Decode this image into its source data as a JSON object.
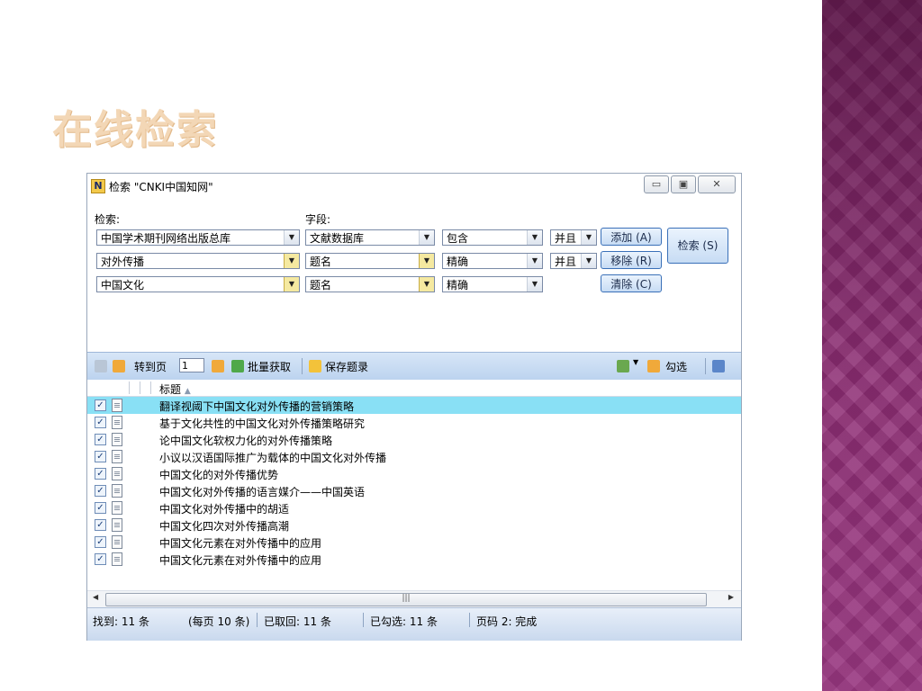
{
  "slide": {
    "title": "在线检索"
  },
  "window": {
    "title": "检索 \"CNKI中国知网\"",
    "app_icon": "N"
  },
  "search": {
    "label_search": "检索:",
    "label_field": "字段:",
    "rows": [
      {
        "source": "中国学术期刊网络出版总库",
        "field": "文献数据库",
        "match": "包含",
        "logic": "并且"
      },
      {
        "source": "对外传播",
        "field": "题名",
        "match": "精确",
        "logic": "并且"
      },
      {
        "source": "中国文化",
        "field": "题名",
        "match": "精确",
        "logic": ""
      }
    ],
    "buttons": {
      "add": "添加 (A)",
      "remove": "移除 (R)",
      "clear": "清除 (C)",
      "search": "检索 (S)"
    }
  },
  "toolbar": {
    "goto_label": "转到页",
    "page_value": "1",
    "batch_label": "批量获取",
    "save_label": "保存题录",
    "check_label": "勾选"
  },
  "list": {
    "header_title": "标题",
    "items": [
      "翻译视阈下中国文化对外传播的营销策略",
      "基于文化共性的中国文化对外传播策略研究",
      "论中国文化软权力化的对外传播策略",
      "小议以汉语国际推广为载体的中国文化对外传播",
      "中国文化的对外传播优势",
      "中国文化对外传播的语言媒介——中国英语",
      "中国文化对外传播中的胡适",
      "中国文化四次对外传播高潮",
      "中国文化元素在对外传播中的应用",
      "中国文化元素在对外传播中的应用"
    ],
    "selected_index": 0
  },
  "status": {
    "found": "找到: 11 条",
    "per_page": "(每页 10 条)",
    "retrieved": "已取回: 11 条",
    "checked": "已勾选: 11 条",
    "page": "页码 2: 完成"
  },
  "colors": {
    "title": "#f3d7b6",
    "selected_row": "#89e0f5",
    "deco": "#8e2d74"
  }
}
